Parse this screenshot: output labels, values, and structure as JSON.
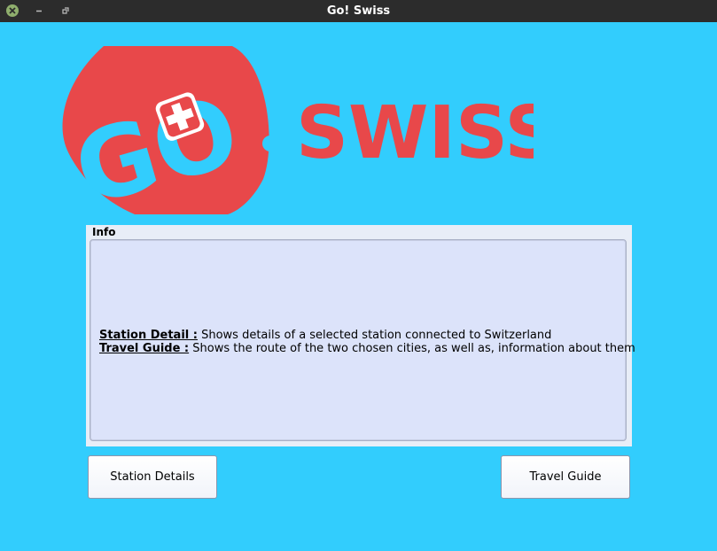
{
  "window": {
    "title": "Go! Swiss"
  },
  "logo": {
    "go_text": "GO",
    "brand_text": "SWISS",
    "brand_color": "#e8484a",
    "cross_color": "#ffffff"
  },
  "info": {
    "title": "Info",
    "lines": [
      {
        "label": "Station Detail :",
        "text": " Shows details of a selected station connected to Switzerland"
      },
      {
        "label": "Travel Guide :",
        "text": " Shows the route of the two chosen cities, as well as, information about them"
      }
    ]
  },
  "buttons": {
    "station": "Station Details",
    "travel": "Travel Guide"
  },
  "colors": {
    "background": "#32cdfd",
    "titlebar": "#2c2c2c",
    "panel": "#e8edf7",
    "text_box": "#dce3fa"
  }
}
